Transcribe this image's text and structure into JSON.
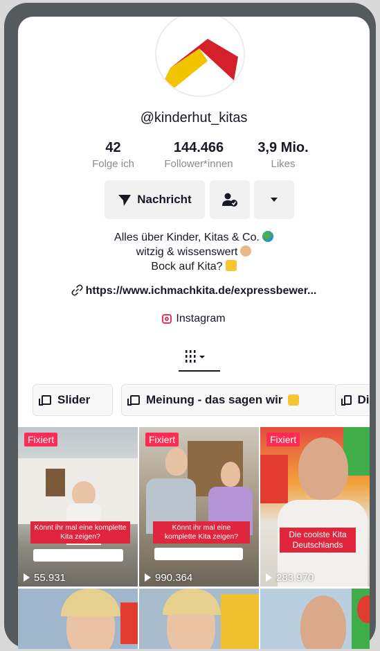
{
  "profile": {
    "username": "@kinderhut_kitas",
    "stats": [
      {
        "value": "42",
        "label": "Folge ich"
      },
      {
        "value": "144.466",
        "label": "Follower*innen"
      },
      {
        "value": "3,9 Mio.",
        "label": "Likes"
      }
    ],
    "buttons": {
      "message": "Nachricht",
      "add_friend_icon": "add-friend-icon",
      "more_icon": "caret-down-icon"
    },
    "bio_lines": [
      "Alles über Kinder, Kitas & Co.",
      "witzig & wissenswert",
      "Bock auf Kita?"
    ],
    "link": "https://www.ichmachkita.de/expressbewer...",
    "instagram": "Instagram"
  },
  "playlists": [
    "Slider",
    "Meinung - das sagen wir",
    "Die"
  ],
  "videos": [
    {
      "badge": "Fixiert",
      "caption": "Könnt ihr mal eine komplette Kita zeigen?",
      "views": "55.931"
    },
    {
      "badge": "Fixiert",
      "caption": "Könnt ihr mal eine komplette Kita zeigen?",
      "views": "990.364"
    },
    {
      "badge": "Fixiert",
      "caption": "Die coolste Kita Deutschlands",
      "views": "283.970"
    }
  ],
  "colors": {
    "accent": "#fe2c55",
    "logo_yellow": "#f2c400",
    "logo_red": "#d4202a"
  }
}
